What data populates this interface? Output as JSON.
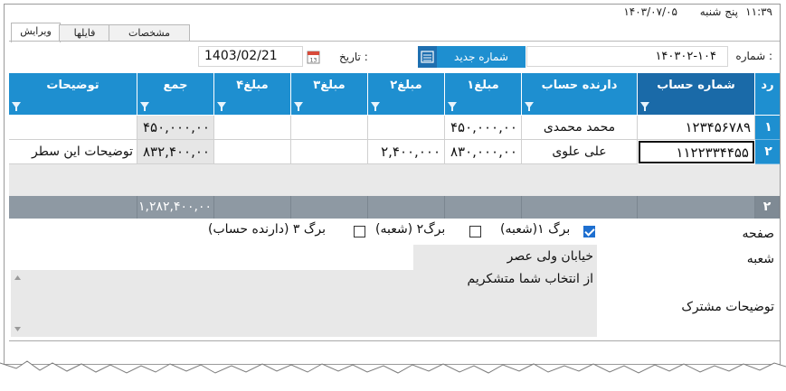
{
  "window": {
    "time": "۱۱:۳۹",
    "day": "پنج شنبه",
    "date": "۱۴۰۳/۰۷/۰۵"
  },
  "tabs": [
    "ویرایش",
    "فایلها",
    "مشخصات"
  ],
  "form": {
    "number_label": ": شماره",
    "number_value": "۱۴۰۳۰۲-۱۰۴",
    "new_number_button": "شماره جدید",
    "date_label": ": تاریخ",
    "date_value": "1403/02/21"
  },
  "grid": {
    "columns": [
      "رد",
      "شماره حساب",
      "دارنده حساب",
      "مبلغ۱",
      "مبلغ۲",
      "مبلغ۳",
      "مبلغ۴",
      "جمع",
      "توضیحات"
    ],
    "rows": [
      {
        "num": "۱",
        "account": "۱۲۳۴۵۶۷۸۹",
        "holder": "محمد محمدی",
        "m1": "۴۵۰,۰۰۰,۰۰",
        "m2": "",
        "m3": "",
        "m4": "",
        "total": "۴۵۰,۰۰۰,۰۰",
        "desc": ""
      },
      {
        "num": "۲",
        "account": "۱۱۲۲۳۳۴۴۵۵",
        "holder": "علی علوی",
        "m1": "۸۳۰,۰۰۰,۰۰",
        "m2": "۲,۴۰۰,۰۰۰",
        "m3": "",
        "m4": "",
        "total": "۸۳۲,۴۰۰,۰۰",
        "desc": "توضیحات این سطر"
      }
    ],
    "footer_count": "۲",
    "footer_total": "۱,۲۸۲,۴۰۰,۰۰"
  },
  "bottom": {
    "page_label": "صفحه",
    "checks": [
      {
        "label": "برگ ۱(شعبه)",
        "checked": true
      },
      {
        "label": "برگ۲ (شعبه)",
        "checked": false
      },
      {
        "label": "برگ ۳ (دارنده حساب)",
        "checked": false
      }
    ],
    "branch_label": "شعبه",
    "branch_value": "خیابان ولی عصر",
    "notes_label": "توضیحات مشترک",
    "notes_value": "از انتخاب شما متشکریم"
  },
  "colors": {
    "header": "#1e8fd0",
    "header_active": "#1a6aa8",
    "footer": "#8e99a3",
    "button": "#1e8fd0"
  }
}
